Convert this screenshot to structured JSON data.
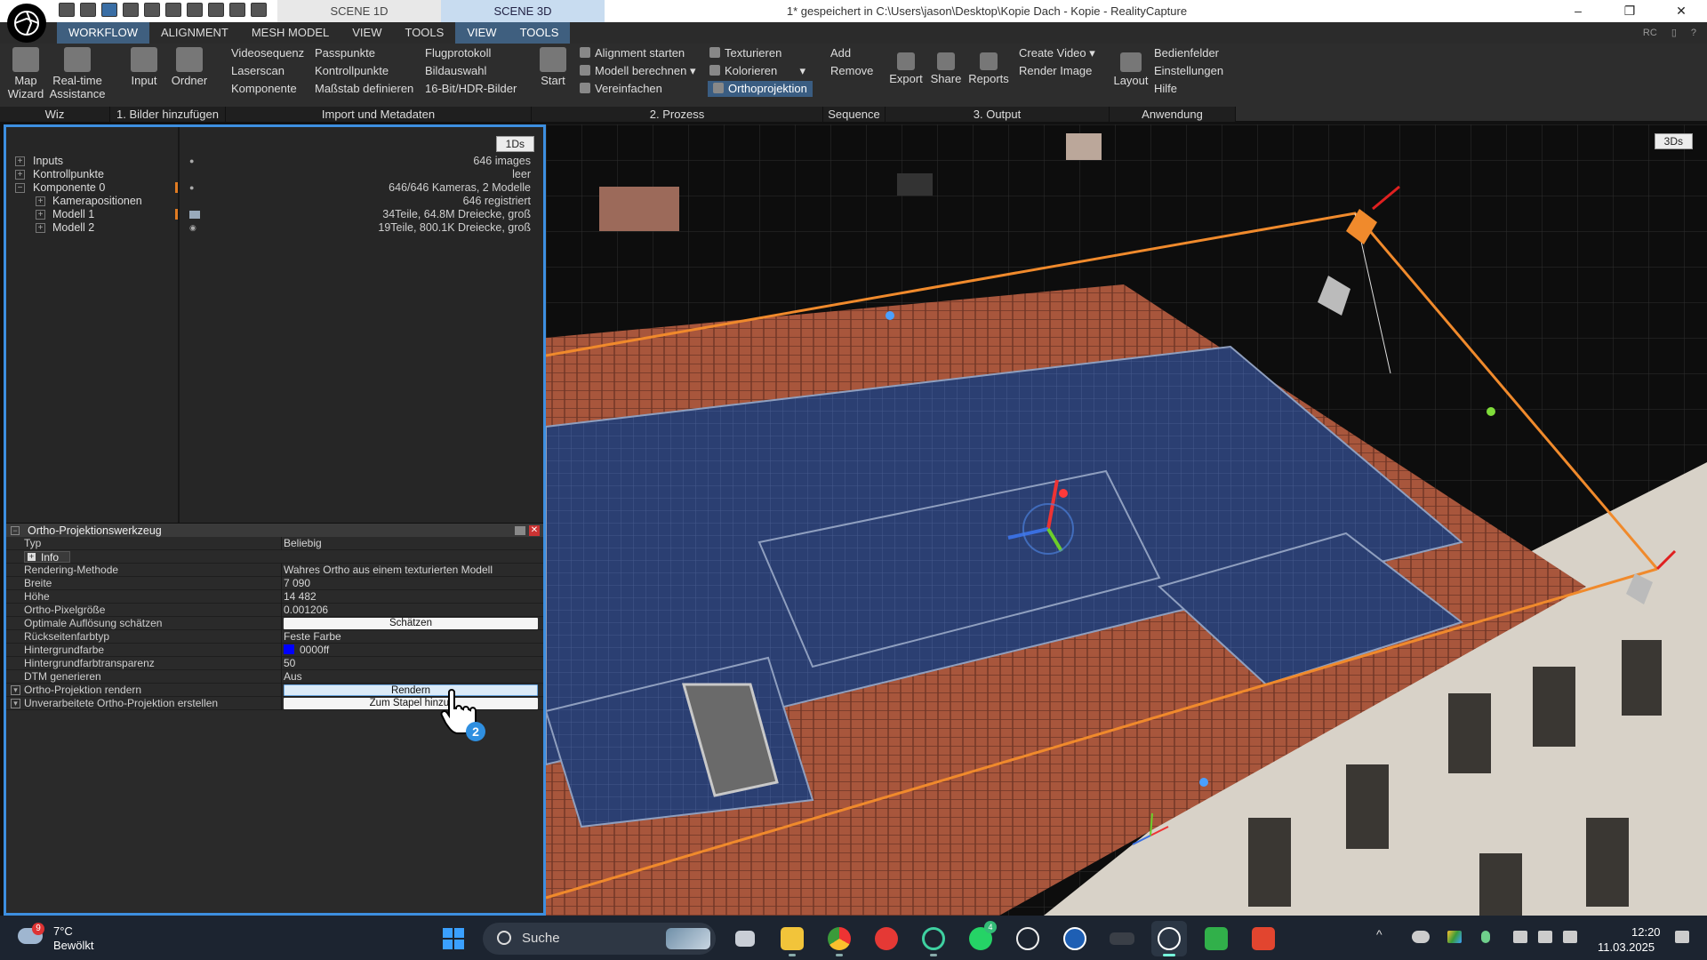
{
  "titlebar": {
    "scene_tabs": [
      "SCENE 1D",
      "SCENE 3D"
    ],
    "window_title": "1* gespeichert in C:\\Users\\jason\\Desktop\\Kopie Dach - Kopie - RealityCapture"
  },
  "menu": {
    "tabs": [
      "WORKFLOW",
      "ALIGNMENT",
      "MESH MODEL",
      "VIEW",
      "TOOLS",
      "VIEW",
      "TOOLS"
    ],
    "right_label": "RC"
  },
  "ribbon": {
    "wiz": {
      "map_wizard": "Map Wizard",
      "realtime": "Real-time Assistance",
      "label": "Wiz"
    },
    "bilder": {
      "input": "Input",
      "ordner": "Ordner",
      "label": "1. Bilder hinzufügen"
    },
    "import": {
      "items": [
        "Videosequenz",
        "Laserscan",
        "Komponente",
        "Passpunkte",
        "Kontrollpunkte",
        "Maßstab definieren",
        "Flugprotokoll",
        "Bildauswahl",
        "16-Bit/HDR-Bilder"
      ],
      "label": "Import und Metadaten"
    },
    "prozess": {
      "start": "Start",
      "items": [
        "Alignment starten",
        "Modell berechnen",
        "Vereinfachen",
        "Texturieren",
        "Kolorieren",
        "Orthoprojektion"
      ],
      "label": "2. Prozess"
    },
    "sequence": {
      "add": "Add",
      "remove": "Remove",
      "label": "Sequence"
    },
    "output": {
      "export": "Export",
      "share": "Share",
      "reports": "Reports",
      "create_video": "Create Video",
      "render_image": "Render Image",
      "label": "3. Output"
    },
    "anwendung": {
      "layout": "Layout",
      "bedienfelder": "Bedienfelder",
      "einstellungen": "Einstellungen",
      "hilfe": "Hilfe",
      "label": "Anwendung"
    }
  },
  "left_panel": {
    "view_tag": "1Ds",
    "tree": [
      {
        "label": "Inputs",
        "value": "646 images"
      },
      {
        "label": "Kontrollpunkte",
        "value": "leer"
      },
      {
        "label": "Komponente 0",
        "value": "646/646 Kameras, 2 Modelle"
      },
      {
        "label": "Kamerapositionen",
        "value": "646 registriert"
      },
      {
        "label": "Modell 1",
        "value": "34Teile, 64.8M Dreiecke, groß"
      },
      {
        "label": "Modell 2",
        "value": "19Teile, 800.1K Dreiecke, groß"
      }
    ],
    "tool": {
      "title": "Ortho-Projektionswerkzeug",
      "props": {
        "typ": {
          "name": "Typ",
          "value": "Beliebig"
        },
        "info": "Info",
        "rendering": {
          "name": "Rendering-Methode",
          "value": "Wahres Ortho aus einem texturierten Modell"
        },
        "breite": {
          "name": "Breite",
          "value": "7 090"
        },
        "hoehe": {
          "name": "Höhe",
          "value": "14 482"
        },
        "pixel": {
          "name": "Ortho-Pixelgröße",
          "value": "0.001206"
        },
        "aufloesung": {
          "name": "Optimale Auflösung schätzen",
          "button": "Schätzen"
        },
        "rueckseite": {
          "name": "Rückseitenfarbtyp",
          "value": "Feste Farbe"
        },
        "hintergrund": {
          "name": "Hintergrundfarbe",
          "value": "0000ff",
          "color": "#0000ff"
        },
        "transparenz": {
          "name": "Hintergrundfarbtransparenz",
          "value": "50"
        },
        "dtm": {
          "name": "DTM generieren",
          "value": "Aus"
        },
        "render": {
          "name": "Ortho-Projektion rendern",
          "button": "Rendern"
        },
        "unverarbeitet": {
          "name": "Unverarbeitete Ortho-Projektion erstellen",
          "button": "Zum Stapel hinzuf"
        }
      },
      "cursor_step": "2"
    }
  },
  "viewport": {
    "view_tag": "3Ds"
  },
  "taskbar": {
    "weather": {
      "temp": "7°C",
      "desc": "Bewölkt",
      "badge": "9"
    },
    "search": "Suche",
    "whatsapp_badge": "4",
    "time": "12:20",
    "date": "11.03.2025"
  },
  "colors": {
    "accent_blue": "#3d8fe0",
    "bbox_orange": "#f08a2c",
    "panel_bg": "#2a2a2a"
  }
}
